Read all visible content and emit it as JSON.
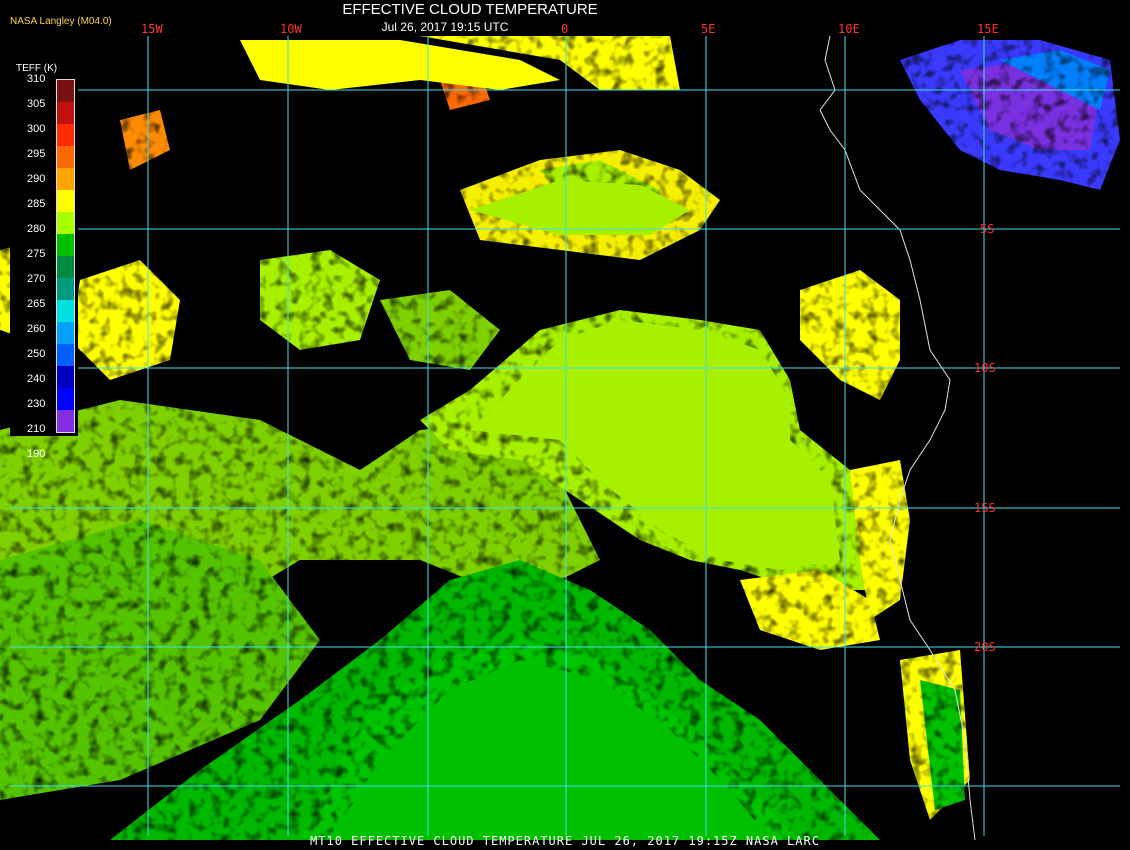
{
  "header": {
    "title": "EFFECTIVE CLOUD TEMPERATURE",
    "subtitle": "Jul 26, 2017 19:15 UTC",
    "credit": "NASA Langley (M04.0)"
  },
  "footer": "MT10  EFFECTIVE CLOUD TEMPERATURE  JUL 26, 2017 19:15Z  NASA LARC",
  "legend": {
    "unit_label": "TEFF (K)",
    "ticks": [
      "310",
      "305",
      "300",
      "295",
      "290",
      "285",
      "280",
      "275",
      "270",
      "265",
      "260",
      "250",
      "240",
      "230",
      "210",
      "190"
    ],
    "colors": [
      "#7a1010",
      "#c01010",
      "#ff2a00",
      "#ff6a00",
      "#ffa500",
      "#ffff00",
      "#a8ff00",
      "#00c000",
      "#008a40",
      "#009a80",
      "#00e0e0",
      "#00a0ff",
      "#0060ff",
      "#0000c0",
      "#0000ff",
      "#8030e0"
    ]
  },
  "map": {
    "longitude_labels": [
      "15W",
      "10W",
      "0",
      "5E",
      "10E",
      "15E"
    ],
    "latitude_labels": [
      "5S",
      "10S",
      "15S",
      "20S"
    ]
  }
}
